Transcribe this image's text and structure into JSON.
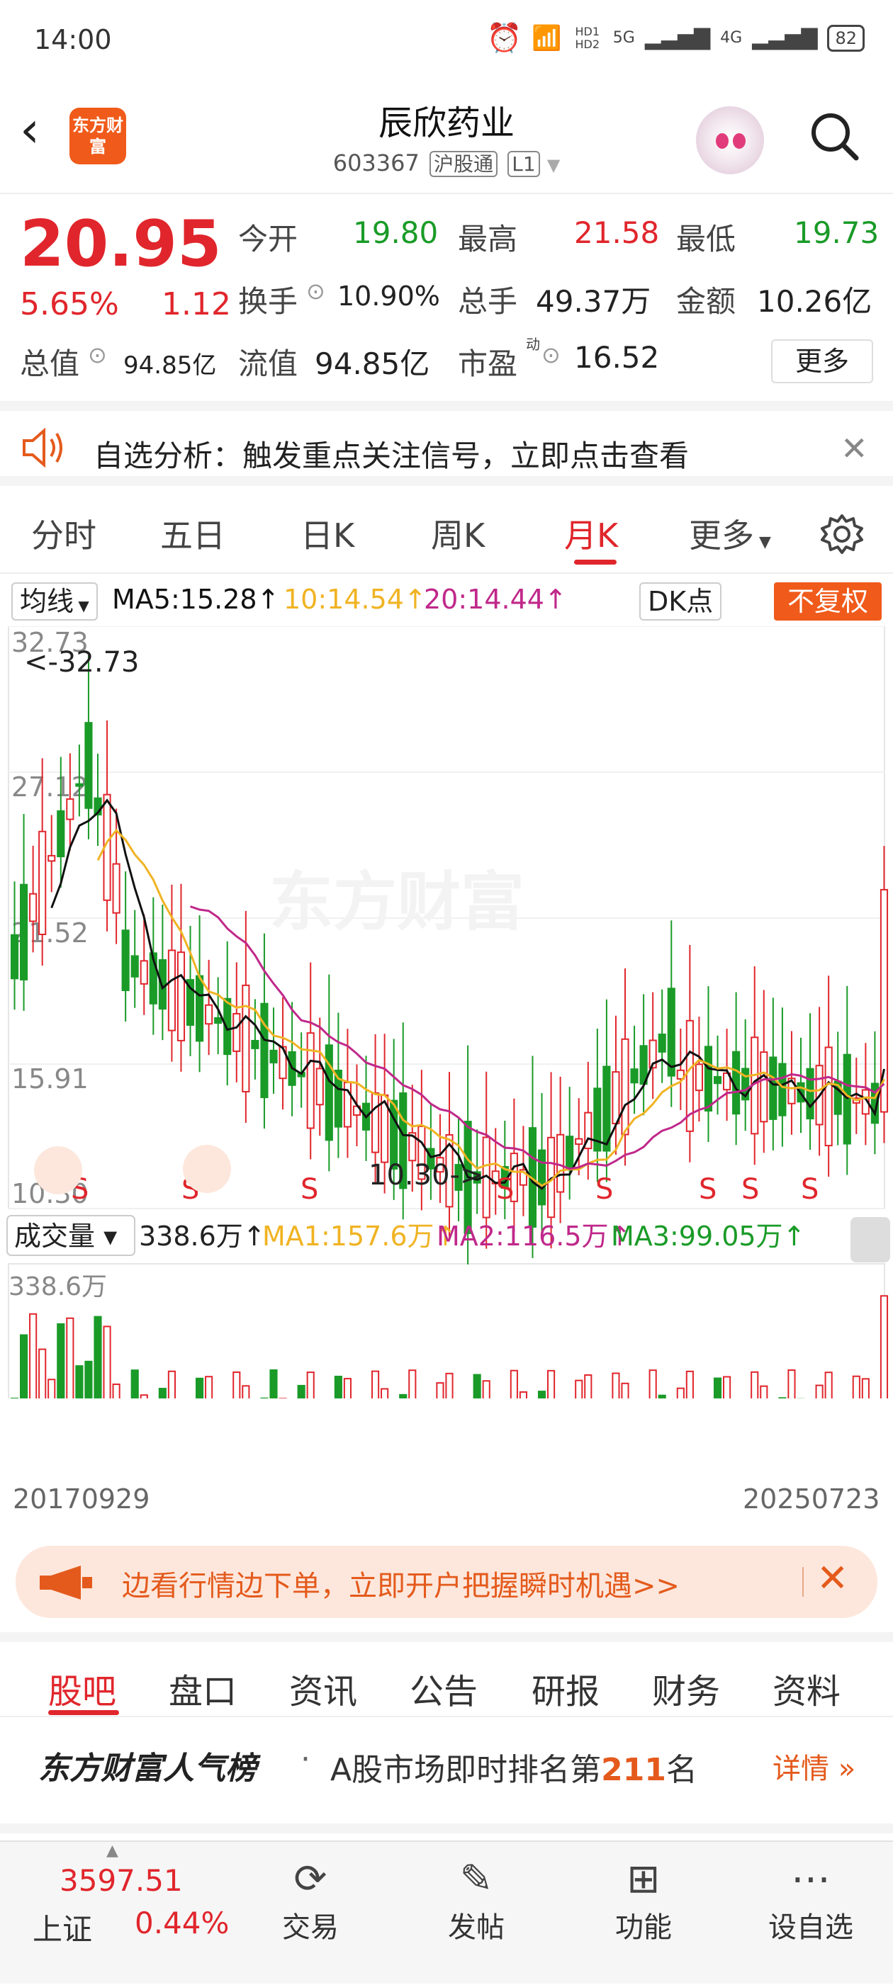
{
  "status_bar": {
    "time": "14:00",
    "network_1": "5G",
    "network_2": "4G",
    "hd": "HD1 HD2",
    "battery": "82"
  },
  "header": {
    "title": "辰欣药业",
    "code": "603367",
    "tag_market": "沪股通",
    "tag_level": "L1",
    "logo_text": "东方财富"
  },
  "quote": {
    "price": "20.95",
    "change_pct": "5.65%",
    "change": "1.12",
    "open_label": "今开",
    "open": "19.80",
    "high_label": "最高",
    "high": "21.58",
    "low_label": "最低",
    "low": "19.73",
    "turnover_label": "换手",
    "turnover": "10.90%",
    "volume_label": "总手",
    "volume": "49.37万",
    "amount_label": "金额",
    "amount": "10.26亿",
    "total_value_label": "总值",
    "total_value": "94.85亿",
    "float_value_label": "流值",
    "float_value": "94.85亿",
    "pe_label": "市盈",
    "pe_sup": "动",
    "pe": "16.52",
    "more_label": "更多"
  },
  "notice": {
    "text": "自选分析：触发重点关注信号，立即点击查看"
  },
  "tabs": [
    "分时",
    "五日",
    "日K",
    "周K",
    "月K",
    "更多"
  ],
  "active_tab": "月K",
  "chart_controls": {
    "indicator": "均线",
    "ma5": "MA5:15.28↑",
    "ma10": "10:14.54↑",
    "ma20": "20:14.44↑",
    "dk": "DK点",
    "adjust": "不复权"
  },
  "chart_data": {
    "type": "candlestick",
    "price_axis_labels": [
      "32.73",
      "27.12",
      "21.52",
      "15.91",
      "10.30"
    ],
    "max_marker": "<-32.73",
    "min_marker": "10.30->",
    "signal_label": "S",
    "watermark": "东方财富",
    "x_start": "20170929",
    "x_end": "20250723",
    "volume_panel": {
      "indicator": "成交量",
      "value": "338.6万↑",
      "ma1": "MA1:157.6万↑",
      "ma2": "MA2:116.5万↑",
      "ma3": "MA3:99.05万↑",
      "axis_max": "338.6万"
    },
    "colors": {
      "up": "#e0262c",
      "down": "#1a9b28",
      "ma5": "#111111",
      "ma10": "#f0b323",
      "ma20": "#c0288a"
    }
  },
  "banner": {
    "text": "边看行情边下单，立即开户把握瞬时机遇>>"
  },
  "subtabs": [
    "股吧",
    "盘口",
    "资讯",
    "公告",
    "研报",
    "财务",
    "资料"
  ],
  "active_subtab": "股吧",
  "rank": {
    "brand": "东方财富人气榜",
    "text_prefix": "A股市场即时排名第",
    "rank": "211",
    "text_suffix": "名",
    "detail": "详情"
  },
  "bottom_nav": {
    "index_value": "3597.51",
    "index_name": "上证",
    "index_change": "0.44%",
    "items": [
      "交易",
      "发帖",
      "功能",
      "设自选"
    ]
  }
}
